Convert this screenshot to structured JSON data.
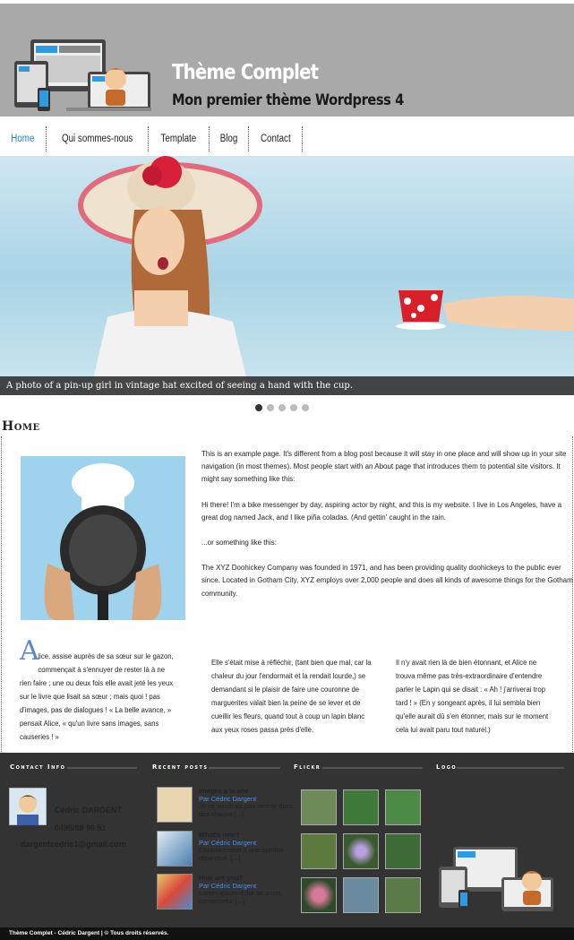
{
  "header": {
    "site_title": "Thème Complet",
    "site_description": "Mon premier thème Wordpress 4"
  },
  "nav": {
    "items": [
      {
        "label": "Home",
        "active": true
      },
      {
        "label": "Qui sommes-nous",
        "active": false
      },
      {
        "label": "Template",
        "active": false
      },
      {
        "label": "Blog",
        "active": false
      },
      {
        "label": "Contact",
        "active": false
      }
    ]
  },
  "slider": {
    "caption": "A photo of a pin-up girl in vintage hat excited of seeing a hand with the cup.",
    "slide_count": 5,
    "active_slide": 1
  },
  "main": {
    "page_title": "Home",
    "intro": [
      "This is an example page. It's different from a blog post because it will stay in one place and will show up in your site navigation (in most themes). Most people start with an About page that introduces them to potential site visitors. It might say something like this:",
      "Hi there! I'm a bike messenger by day, aspiring actor by night, and this is my website. I live in Los Angeles, have a great dog named Jack, and I like piña coladas. (And gettin' caught in the rain.",
      "...or something like this:",
      "The XYZ Doohickey Company was founded in 1971, and has been providing quality doohickeys to the public ever since. Located in Gotham City, XYZ employs over 2,000 people and does all kinds of awesome things for the Gotham community."
    ],
    "col1_dropcap": "A",
    "col1": "lice, assise auprès de sa sœur sur le gazon, commençait à s'ennuyer de rester là à ne rien faire ; une ou deux fois elle avait jeté les yeux sur le livre que lisait sa sœur ; mais quoi ! pas d'images, pas de dialogues ! « La belle avance, » pensait Alice, « qu'un livre sans images, sans causeries ! »",
    "col2": "Elle s'était mise à réfléchir, (tant bien que mal, car la chaleur du jour l'endormait et la rendait lourde,) se demandant si le plaisir de faire une couronne de marguerites valait bien la peine de se lever et de cueillir les fleurs, quand tout à coup un lapin blanc aux yeux roses passa près d'elle.",
    "col3": "Il n'y avait rien là de bien étonnant, et Alice ne trouva même pas très-extraordinaire d'entendre parler le Lapin qui se disait : « Ah ! j'arriverai trop tard ! » (En y songeant après, il lui sembla bien qu'elle aurait dû s'en étonner, mais sur le moment cela lui avait paru tout naturel.)"
  },
  "footer": {
    "headings": {
      "contact": "Contact Info",
      "recent": "Recent posts",
      "flickr": "Flickr",
      "logo": "Logo"
    },
    "contact": {
      "name": "Cédric DARGENT",
      "phone": "0495/88 90 51",
      "email": "dargentcedric1@gmail.com"
    },
    "recent_posts": [
      {
        "title": "Images à la une",
        "author": "Par Cédric Dargent",
        "excerpt": "Je ne voudrais pas rentrer dans des choses   [...]"
      },
      {
        "title": "What's new?",
        "author": "Par Cédric Dargent",
        "excerpt": "Contrairement à une opinion répandue, [...]"
      },
      {
        "title": "How are you?",
        "author": "Par Cédric Dargent",
        "excerpt": "Lorem ipsum dolor sit amet, consectetur [...]"
      }
    ],
    "copyright": "Thème Complet - Cédric Dargent | © Tous droits réservés."
  }
}
